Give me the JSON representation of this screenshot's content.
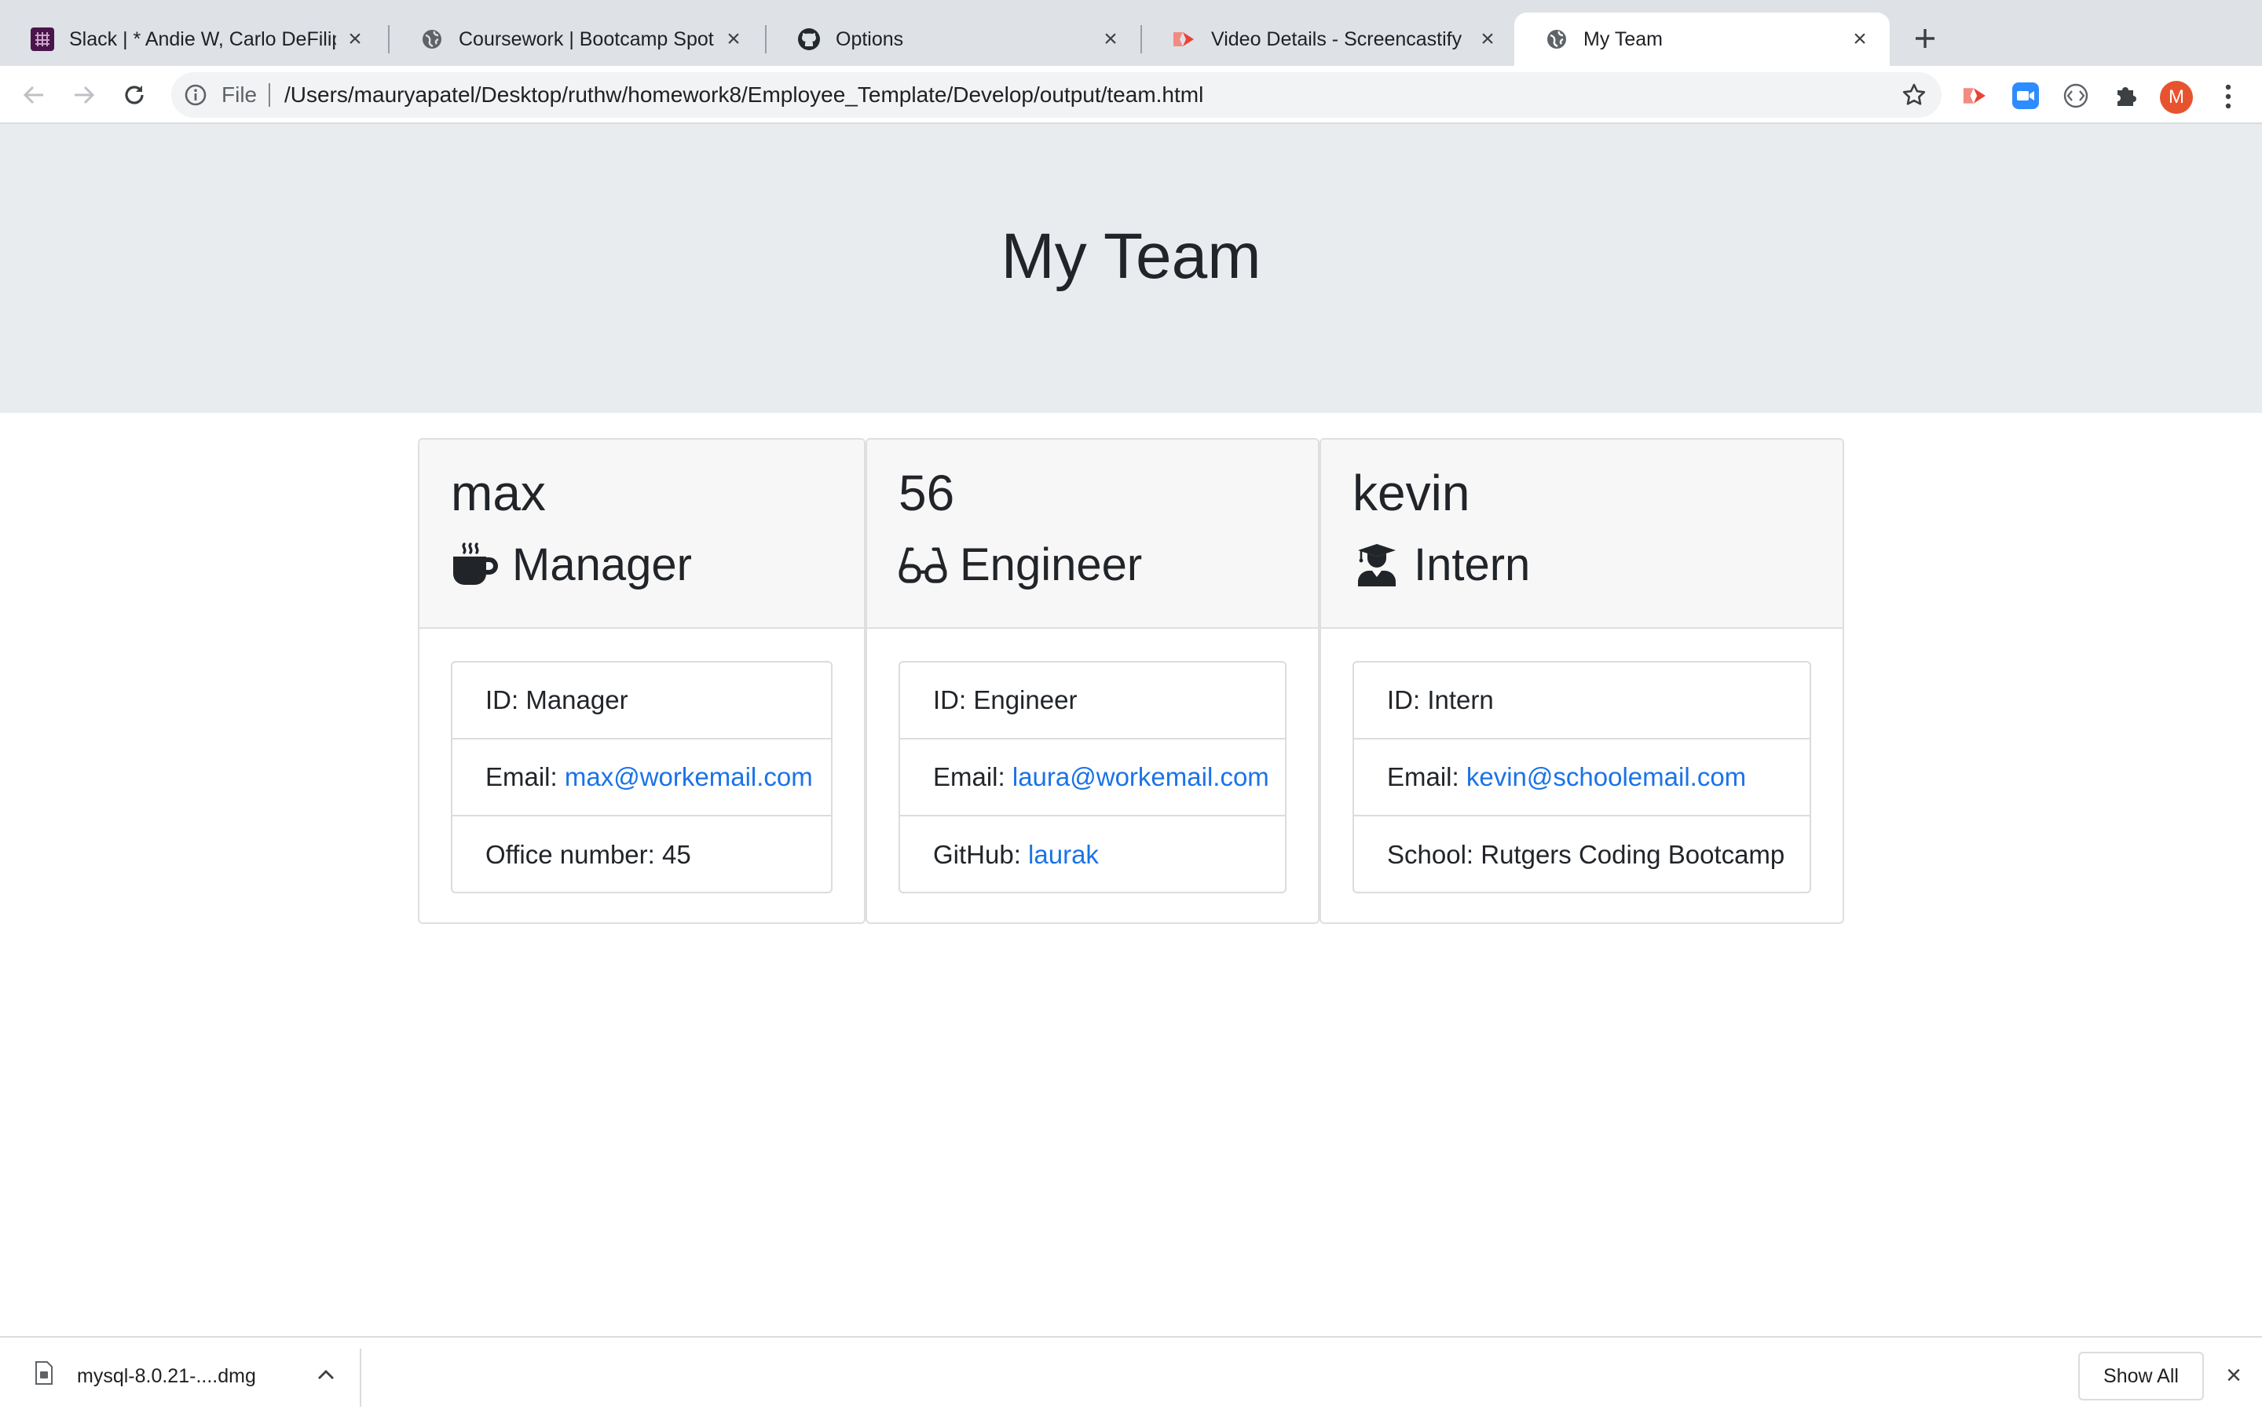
{
  "browser": {
    "tabs": [
      {
        "title": "Slack | * Andie W, Carlo DeFilip",
        "favicon": "slack-icon",
        "active": false
      },
      {
        "title": "Coursework | Bootcamp Spot",
        "favicon": "globe-icon",
        "active": false
      },
      {
        "title": "Options",
        "favicon": "github-icon",
        "active": false
      },
      {
        "title": "Video Details - Screencastify",
        "favicon": "screencastify-icon",
        "active": false
      },
      {
        "title": "My Team",
        "favicon": "globe-icon",
        "active": true
      }
    ],
    "omnibox": {
      "scheme_label": "File",
      "url": "/Users/mauryapatel/Desktop/ruthw/homework8/Employee_Template/Develop/output/team.html"
    },
    "profile_initial": "M"
  },
  "page": {
    "heading": "My Team",
    "cards": [
      {
        "name": "max",
        "role": "Manager",
        "role_icon": "mug-icon",
        "id_text": "ID: Manager",
        "email_label": "Email: ",
        "email": "max@workemail.com",
        "extra_label": "Office number: 45",
        "extra_value": ""
      },
      {
        "name": "56",
        "role": "Engineer",
        "role_icon": "glasses-icon",
        "id_text": "ID: Engineer",
        "email_label": "Email: ",
        "email": "laura@workemail.com",
        "extra_label": "GitHub: ",
        "extra_value": "laurak"
      },
      {
        "name": "kevin",
        "role": "Intern",
        "role_icon": "graduate-icon",
        "id_text": "ID: Intern",
        "email_label": "Email: ",
        "email": "kevin@schoolemail.com",
        "extra_label": "School: Rutgers Coding Bootcamp",
        "extra_value": ""
      }
    ]
  },
  "downloads": {
    "filename": "mysql-8.0.21-....dmg",
    "show_all_label": "Show All"
  },
  "colors": {
    "link": "#1a73e8",
    "jumbotron_bg": "#e9ecef",
    "tabstrip_bg": "#dee1e6"
  }
}
